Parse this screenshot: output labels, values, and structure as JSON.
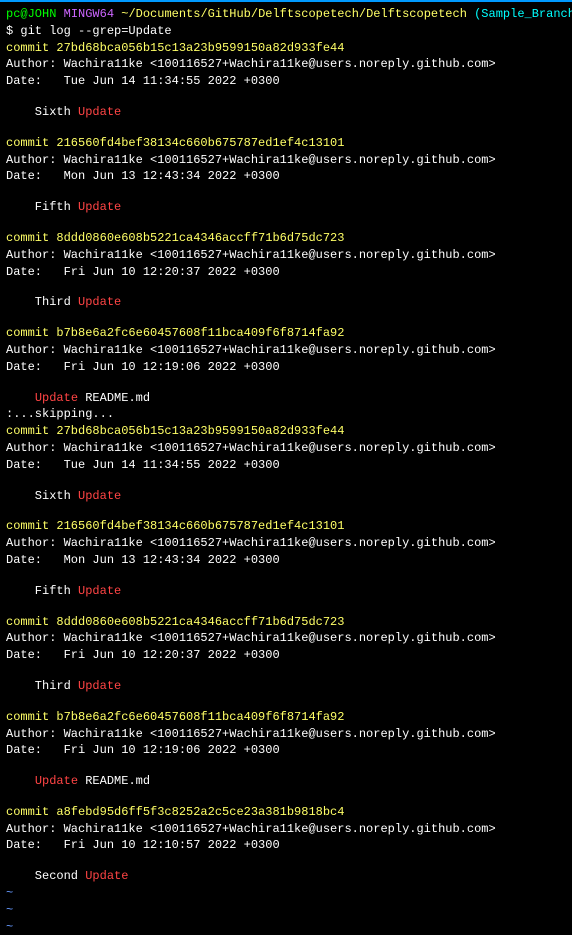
{
  "prompt": {
    "user_host": "pc@JOHN",
    "shell": "MINGW64",
    "path": "~/Documents/GitHub/Delftscopetech/Delftscopetech",
    "branch": "(Sample_Branch)"
  },
  "command": "$ git log --grep=Update",
  "commits": [
    {
      "hash": "commit 27bd68bca056b15c13a23b9599150a82d933fe44",
      "author": "Author: Wachira11ke <100116527+Wachira11ke@users.noreply.github.com>",
      "date": "Date:   Tue Jun 14 11:34:55 2022 +0300",
      "message_prefix": "    Sixth ",
      "message_highlight": "Update"
    },
    {
      "hash": "commit 216560fd4bef38134c660b675787ed1ef4c13101",
      "author": "Author: Wachira11ke <100116527+Wachira11ke@users.noreply.github.com>",
      "date": "Date:   Mon Jun 13 12:43:34 2022 +0300",
      "message_prefix": "    Fifth ",
      "message_highlight": "Update"
    },
    {
      "hash": "commit 8ddd0860e608b5221ca4346accff71b6d75dc723",
      "author": "Author: Wachira11ke <100116527+Wachira11ke@users.noreply.github.com>",
      "date": "Date:   Fri Jun 10 12:20:37 2022 +0300",
      "message_prefix": "    Third ",
      "message_highlight": "Update"
    },
    {
      "hash": "commit b7b8e6a2fc6e60457608f11bca409f6f8714fa92",
      "author": "Author: Wachira11ke <100116527+Wachira11ke@users.noreply.github.com>",
      "date": "Date:   Fri Jun 10 12:19:06 2022 +0300",
      "message_prefix": "    ",
      "message_highlight": "Update",
      "message_suffix": " README.md"
    }
  ],
  "skipping": ":...skipping...",
  "commits2": [
    {
      "hash": "commit 27bd68bca056b15c13a23b9599150a82d933fe44",
      "author": "Author: Wachira11ke <100116527+Wachira11ke@users.noreply.github.com>",
      "date": "Date:   Tue Jun 14 11:34:55 2022 +0300",
      "message_prefix": "    Sixth ",
      "message_highlight": "Update"
    },
    {
      "hash": "commit 216560fd4bef38134c660b675787ed1ef4c13101",
      "author": "Author: Wachira11ke <100116527+Wachira11ke@users.noreply.github.com>",
      "date": "Date:   Mon Jun 13 12:43:34 2022 +0300",
      "message_prefix": "    Fifth ",
      "message_highlight": "Update"
    },
    {
      "hash": "commit 8ddd0860e608b5221ca4346accff71b6d75dc723",
      "author": "Author: Wachira11ke <100116527+Wachira11ke@users.noreply.github.com>",
      "date": "Date:   Fri Jun 10 12:20:37 2022 +0300",
      "message_prefix": "    Third ",
      "message_highlight": "Update"
    },
    {
      "hash": "commit b7b8e6a2fc6e60457608f11bca409f6f8714fa92",
      "author": "Author: Wachira11ke <100116527+Wachira11ke@users.noreply.github.com>",
      "date": "Date:   Fri Jun 10 12:19:06 2022 +0300",
      "message_prefix": "    ",
      "message_highlight": "Update",
      "message_suffix": " README.md"
    },
    {
      "hash": "commit a8febd95d6ff5f3c8252a2c5ce23a381b9818bc4",
      "author": "Author: Wachira11ke <100116527+Wachira11ke@users.noreply.github.com>",
      "date": "Date:   Fri Jun 10 12:10:57 2022 +0300",
      "message_prefix": "    Second ",
      "message_highlight": "Update"
    }
  ],
  "tilde": "~"
}
